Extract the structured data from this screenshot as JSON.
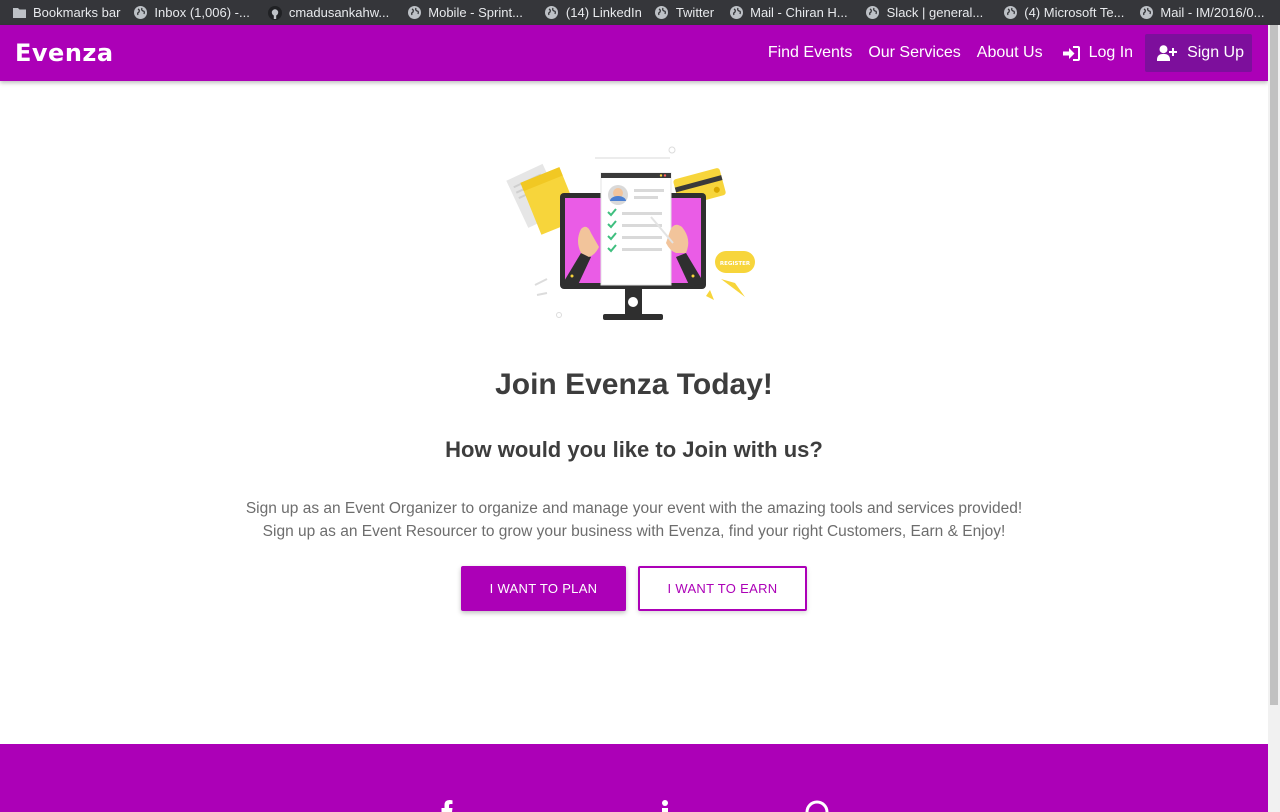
{
  "bookmarks": [
    {
      "label": "Bookmarks bar",
      "icon": "folder-icon"
    },
    {
      "label": "Inbox (1,006) -...",
      "icon": "globe-icon"
    },
    {
      "label": "cmadusankahw...",
      "icon": "github-icon"
    },
    {
      "label": "Mobile - Sprint...",
      "icon": "globe-icon"
    },
    {
      "label": "(14) LinkedIn",
      "icon": "globe-icon"
    },
    {
      "label": "Twitter",
      "icon": "globe-icon"
    },
    {
      "label": "Mail - Chiran H...",
      "icon": "globe-icon"
    },
    {
      "label": "Slack | general...",
      "icon": "globe-icon"
    },
    {
      "label": "(4) Microsoft Te...",
      "icon": "globe-icon"
    },
    {
      "label": "Mail - IM/2016/0...",
      "icon": "globe-icon"
    }
  ],
  "navbar": {
    "brand": "Evenza",
    "links": {
      "find_events": "Find Events",
      "our_services": "Our Services",
      "about_us": "About Us",
      "login": "Log In",
      "signup": "Sign Up"
    },
    "colors": {
      "primary": "#ac00b7",
      "signup_bg": "#7d0f9c"
    }
  },
  "illustration": {
    "register_label": "REGISTER"
  },
  "main": {
    "title": "Join Evenza Today!",
    "subtitle": "How would you like to Join with us?",
    "description_line1": "Sign up as an Event Organizer to organize and manage your event with the amazing tools and services provided!",
    "description_line2": "Sign up as an Event Resourcer to grow your business with Evenza, find your right Customers, Earn & Enjoy!",
    "plan_button": "I WANT TO PLAN",
    "earn_button": "I WANT TO EARN"
  },
  "footer": {
    "icons": [
      "facebook-icon",
      "twitter-icon",
      "linkedin-icon",
      "instagram-icon",
      "github-icon"
    ]
  }
}
